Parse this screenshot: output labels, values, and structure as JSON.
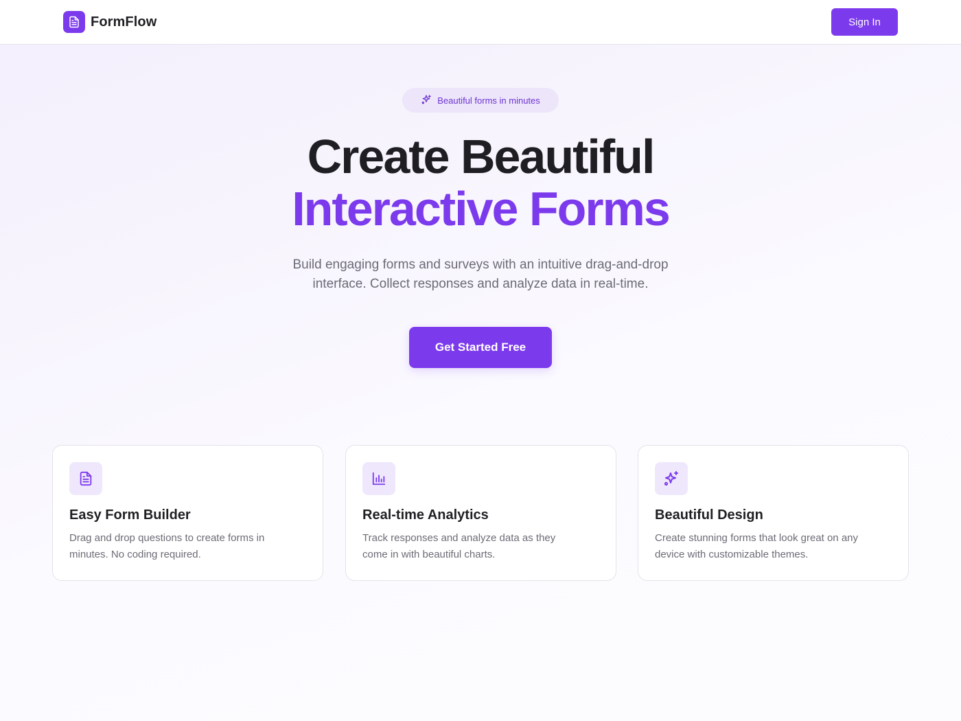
{
  "header": {
    "brand_name": "FormFlow",
    "logo_icon": "document-icon",
    "signin_label": "Sign In"
  },
  "hero": {
    "badge_icon": "sparkles-icon",
    "badge_text": "Beautiful forms in minutes",
    "title_line1": "Create Beautiful",
    "title_line2": "Interactive Forms",
    "subtitle_line1": "Build engaging forms and surveys with an intuitive drag-and-drop",
    "subtitle_line2": "interface. Collect responses and analyze data in real-time.",
    "cta_label": "Get Started Free"
  },
  "features": [
    {
      "icon": "document-icon",
      "title": "Easy Form Builder",
      "desc_line1": "Drag and drop questions to create forms in",
      "desc_line2": "minutes. No coding required."
    },
    {
      "icon": "bar-chart-icon",
      "title": "Real-time Analytics",
      "desc_line1": "Track responses and analyze data as they",
      "desc_line2": "come in with beautiful charts."
    },
    {
      "icon": "sparkles-icon",
      "title": "Beautiful Design",
      "desc_line1": "Create stunning forms that look great on any",
      "desc_line2": "device with customizable themes."
    }
  ],
  "colors": {
    "accent": "#7c3aed",
    "accent_soft": "#efe8fc",
    "text_primary": "#1f1f23",
    "text_muted": "#6b6b76"
  }
}
